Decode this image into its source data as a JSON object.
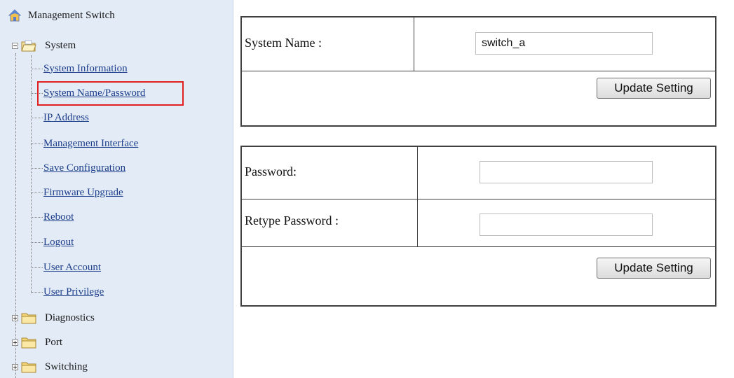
{
  "sidebar": {
    "root": "Management Switch",
    "system_folder": "System",
    "system_items": [
      "System Information",
      "System Name/Password",
      "IP Address",
      "Management Interface",
      "Save Configuration",
      "Firmware Upgrade",
      "Reboot",
      "Logout",
      "User Account",
      "User Privilege"
    ],
    "folders": [
      "Diagnostics",
      "Port",
      "Switching"
    ],
    "selected_item": "System Name/Password",
    "selection_color": "#e0201c"
  },
  "name_form": {
    "label": "System Name :",
    "value": "switch_a",
    "button": "Update Setting"
  },
  "password_form": {
    "password_label": "Password:",
    "retype_label": "Retype Password :",
    "password_value": "",
    "retype_value": "",
    "button": "Update Setting"
  }
}
